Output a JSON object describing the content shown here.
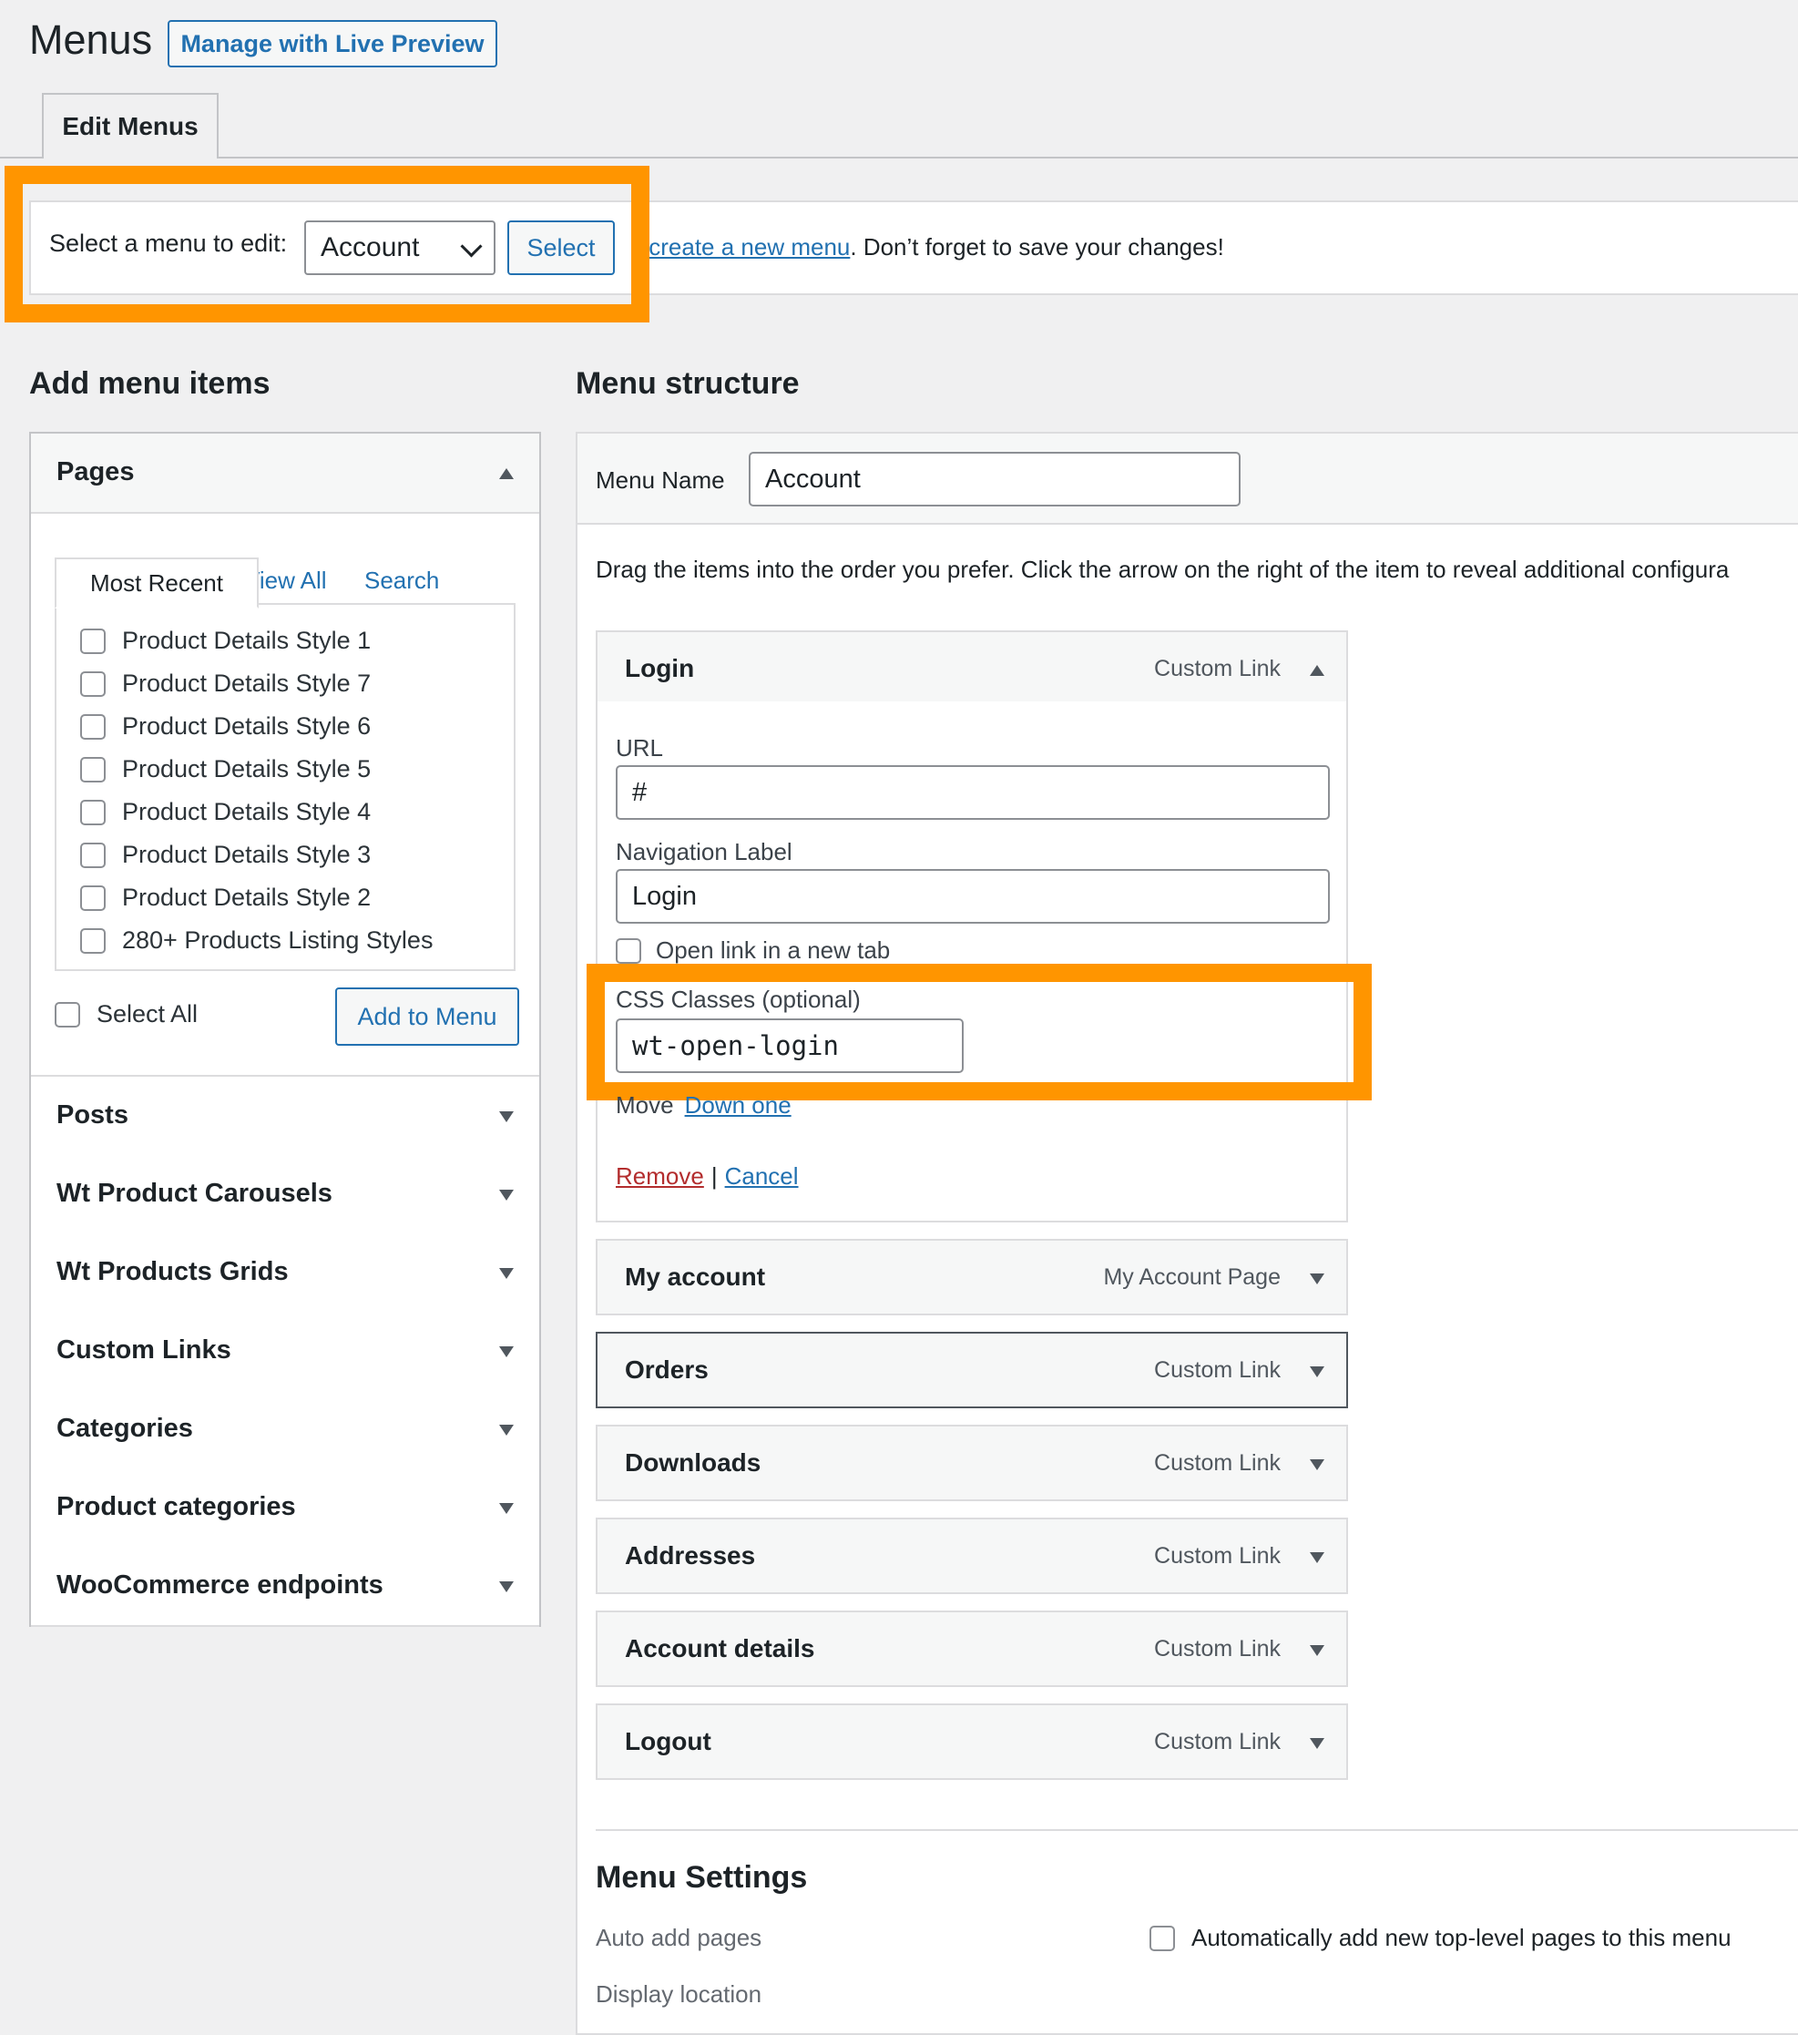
{
  "page": {
    "title": "Menus",
    "live_preview_button": "Manage with Live Preview",
    "tab_edit_menus": "Edit Menus"
  },
  "manage": {
    "select_label": "Select a menu to edit:",
    "selected_menu": "Account",
    "select_button": "Select",
    "hint_lead": "c",
    "hint_link": "create a new menu",
    "hint_tail": ". Don’t forget to save your changes!"
  },
  "add_items": {
    "heading": "Add menu items",
    "pages": {
      "title": "Pages",
      "tabs": [
        "Most Recent",
        "View All",
        "Search"
      ],
      "items": [
        "Product Details Style 1",
        "Product Details Style 7",
        "Product Details Style 6",
        "Product Details Style 5",
        "Product Details Style 4",
        "Product Details Style 3",
        "Product Details Style 2",
        "280+ Products Listing Styles"
      ],
      "select_all": "Select All",
      "add_button": "Add to Menu"
    },
    "sections": [
      "Posts",
      "Wt Product Carousels",
      "Wt Products Grids",
      "Custom Links",
      "Categories",
      "Product categories",
      "WooCommerce endpoints"
    ]
  },
  "structure": {
    "heading": "Menu structure",
    "menu_name_label": "Menu Name",
    "menu_name_value": "Account",
    "instructions": "Drag the items into the order you prefer. Click the arrow on the right of the item to reveal additional configura",
    "login": {
      "title": "Login",
      "type": "Custom Link",
      "url_label": "URL",
      "url_value": "#",
      "nav_label": "Navigation Label",
      "nav_value": "Login",
      "new_tab_label": "Open link in a new tab",
      "css_label": "CSS Classes (optional)",
      "css_value": "wt-open-login",
      "move_label": "Move",
      "move_link": "Down one",
      "remove": "Remove",
      "sep": "|",
      "cancel": "Cancel"
    },
    "items": [
      {
        "title": "My account",
        "type": "My Account Page"
      },
      {
        "title": "Orders",
        "type": "Custom Link"
      },
      {
        "title": "Downloads",
        "type": "Custom Link"
      },
      {
        "title": "Addresses",
        "type": "Custom Link"
      },
      {
        "title": "Account details",
        "type": "Custom Link"
      },
      {
        "title": "Logout",
        "type": "Custom Link"
      }
    ]
  },
  "settings": {
    "heading": "Menu Settings",
    "auto_add_label": "Auto add pages",
    "auto_add_text": "Automatically add new top-level pages to this menu",
    "display_location": "Display location"
  },
  "colors": {
    "highlight": "#ff9500",
    "link": "#2271b1",
    "remove": "#b32d2e"
  }
}
